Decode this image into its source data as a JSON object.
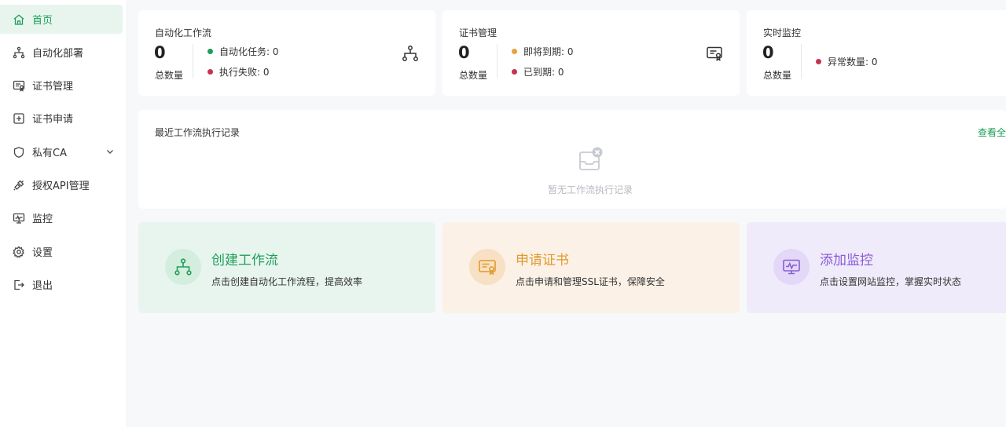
{
  "sidebar": {
    "items": [
      {
        "label": "首页",
        "icon": "home-icon",
        "active": true
      },
      {
        "label": "自动化部署",
        "icon": "workflow-icon"
      },
      {
        "label": "证书管理",
        "icon": "certificate-icon"
      },
      {
        "label": "证书申请",
        "icon": "plus-square-icon"
      },
      {
        "label": "私有CA",
        "icon": "shield-icon",
        "has_submenu": true
      },
      {
        "label": "授权API管理",
        "icon": "api-plug-icon"
      },
      {
        "label": "监控",
        "icon": "monitor-icon"
      },
      {
        "label": "设置",
        "icon": "gear-icon"
      },
      {
        "label": "退出",
        "icon": "logout-icon"
      }
    ]
  },
  "stats": {
    "workflow": {
      "title": "自动化工作流",
      "count": "0",
      "count_label": "总数量",
      "legend": [
        {
          "label": "自动化任务: 0",
          "color": "#1e9e5a"
        },
        {
          "label": "执行失败: 0",
          "color": "#c8324f"
        }
      ],
      "icon": "workflow-icon"
    },
    "certificate": {
      "title": "证书管理",
      "count": "0",
      "count_label": "总数量",
      "legend": [
        {
          "label": "即将到期: 0",
          "color": "#e6a23c"
        },
        {
          "label": "已到期: 0",
          "color": "#c8324f"
        }
      ],
      "icon": "certificate-icon"
    },
    "monitor": {
      "title": "实时监控",
      "count": "0",
      "count_label": "总数量",
      "legend": [
        {
          "label": "异常数量: 0",
          "color": "#c8324f"
        }
      ]
    }
  },
  "recent": {
    "title": "最近工作流执行记录",
    "view_all": "查看全",
    "empty_text": "暂无工作流执行记录"
  },
  "actions": {
    "workflow": {
      "title": "创建工作流",
      "desc": "点击创建自动化工作流程，提高效率",
      "color": "#1e9e5a",
      "bg": "#e8f5ef",
      "circle_bg": "#d3eedf"
    },
    "certificate": {
      "title": "申请证书",
      "desc": "点击申请和管理SSL证书，保障安全",
      "color": "#e09b2d",
      "bg": "#fbf1e6",
      "circle_bg": "#f7e0c3"
    },
    "monitor": {
      "title": "添加监控",
      "desc": "点击设置网站监控，掌握实时状态",
      "color": "#8a5cd6",
      "bg": "#f0ebfb",
      "circle_bg": "#e3d8f7"
    }
  },
  "colors": {
    "accent": "#1e9e5a",
    "danger": "#c8324f",
    "warning": "#e6a23c"
  }
}
